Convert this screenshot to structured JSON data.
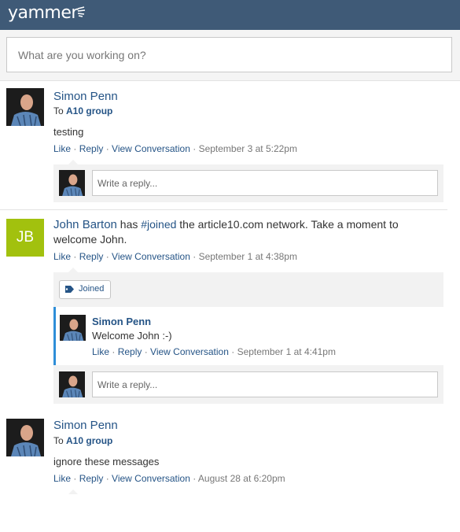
{
  "app": {
    "logo_text": "yammer"
  },
  "composer": {
    "placeholder": "What are you working on?"
  },
  "feed": {
    "post1": {
      "author": "Simon Penn",
      "to_prefix": "To ",
      "group": "A10 group",
      "body": "testing",
      "like": "Like",
      "reply": "Reply",
      "view": "View Conversation",
      "sep": " · ",
      "time": "September 3 at 5:22pm",
      "reply_placeholder": "Write a reply..."
    },
    "post2": {
      "avatar_initials": "JB",
      "author": "John Barton",
      "text_part1": " has ",
      "hashtag": "#joined",
      "text_part2": " the article10.com network. Take a moment to welcome John.",
      "like": "Like",
      "reply": "Reply",
      "view": "View Conversation",
      "sep": " · ",
      "time": "September 1 at 4:38pm",
      "tag": "Joined",
      "nested_reply": {
        "author": "Simon Penn",
        "body": "Welcome John :-)",
        "like": "Like",
        "reply": "Reply",
        "view": "View Conversation",
        "sep": " · ",
        "time": "September 1 at 4:41pm"
      },
      "reply_placeholder": "Write a reply..."
    },
    "post3": {
      "author": "Simon Penn",
      "to_prefix": "To ",
      "group": "A10 group",
      "body": "ignore these messages",
      "like": "Like",
      "reply": "Reply",
      "view": "View Conversation",
      "sep": " · ",
      "time": "August 28 at 6:20pm"
    }
  },
  "colors": {
    "header_bg": "#3f5a77",
    "link": "#255486",
    "jb_avatar": "#a2c10e",
    "nested_accent": "#2e8ed8"
  }
}
